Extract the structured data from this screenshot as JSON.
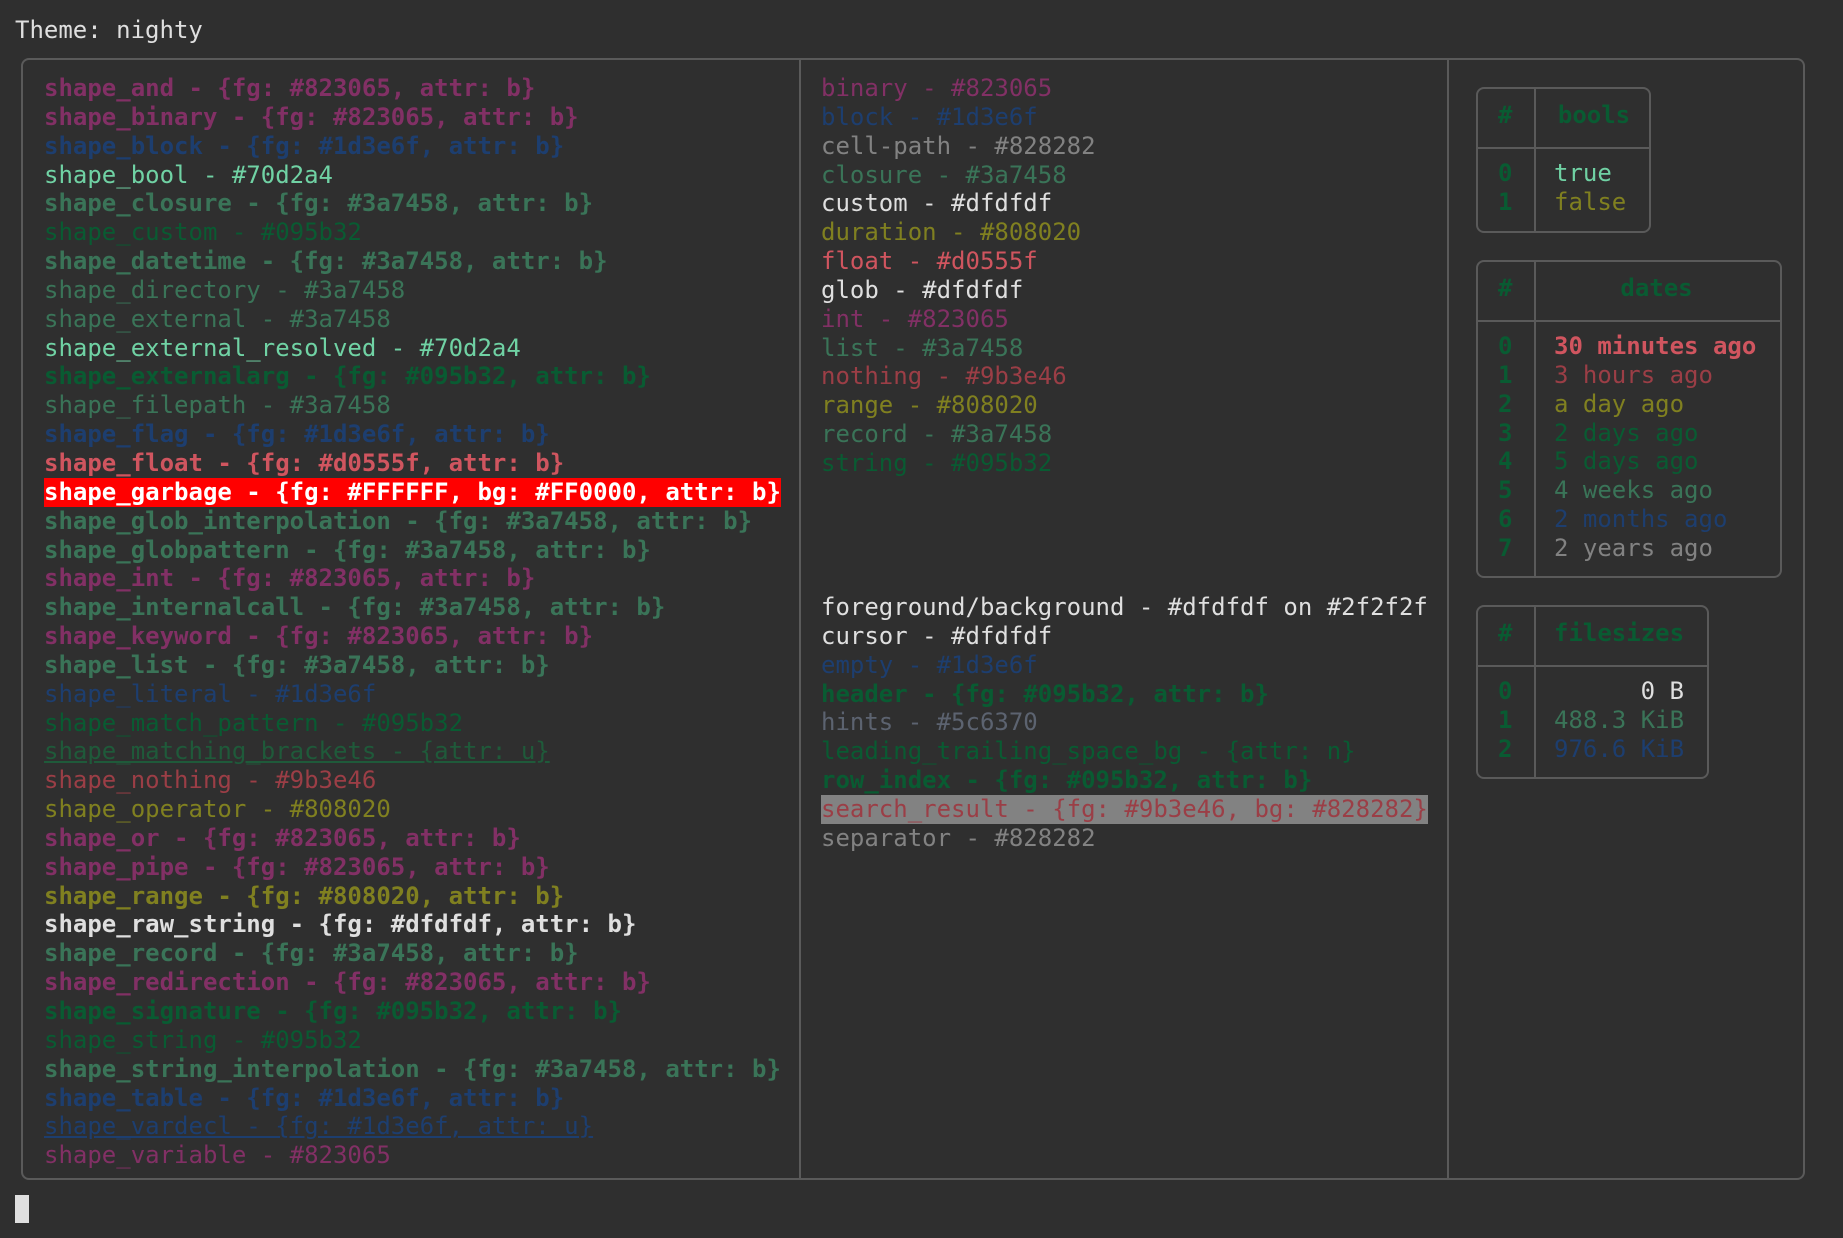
{
  "title": "Theme: nighty",
  "col1": [
    {
      "text": "shape_and - {fg: #823065, attr: b}",
      "color": "#823065",
      "bold": true
    },
    {
      "text": "shape_binary - {fg: #823065, attr: b}",
      "color": "#823065",
      "bold": true
    },
    {
      "text": "shape_block - {fg: #1d3e6f, attr: b}",
      "color": "#1d3e6f",
      "bold": true
    },
    {
      "text": "shape_bool - #70d2a4",
      "color": "#70d2a4"
    },
    {
      "text": "shape_closure - {fg: #3a7458, attr: b}",
      "color": "#3a7458",
      "bold": true
    },
    {
      "text": "shape_custom - #095b32",
      "color": "#095b32"
    },
    {
      "text": "shape_datetime - {fg: #3a7458, attr: b}",
      "color": "#3a7458",
      "bold": true
    },
    {
      "text": "shape_directory - #3a7458",
      "color": "#3a7458"
    },
    {
      "text": "shape_external - #3a7458",
      "color": "#3a7458"
    },
    {
      "text": "shape_external_resolved - #70d2a4",
      "color": "#70d2a4"
    },
    {
      "text": "shape_externalarg - {fg: #095b32, attr: b}",
      "color": "#095b32",
      "bold": true
    },
    {
      "text": "shape_filepath - #3a7458",
      "color": "#3a7458"
    },
    {
      "text": "shape_flag - {fg: #1d3e6f, attr: b}",
      "color": "#1d3e6f",
      "bold": true
    },
    {
      "text": "shape_float - {fg: #d0555f, attr: b}",
      "color": "#d0555f",
      "bold": true
    },
    {
      "text": "shape_garbage - {fg: #FFFFFF, bg: #FF0000, attr: b}",
      "color": "#FFFFFF",
      "bg": "#FF0000",
      "bold": true
    },
    {
      "text": "shape_glob_interpolation - {fg: #3a7458, attr: b}",
      "color": "#3a7458",
      "bold": true
    },
    {
      "text": "shape_globpattern - {fg: #3a7458, attr: b}",
      "color": "#3a7458",
      "bold": true
    },
    {
      "text": "shape_int - {fg: #823065, attr: b}",
      "color": "#823065",
      "bold": true
    },
    {
      "text": "shape_internalcall - {fg: #3a7458, attr: b}",
      "color": "#3a7458",
      "bold": true
    },
    {
      "text": "shape_keyword - {fg: #823065, attr: b}",
      "color": "#823065",
      "bold": true
    },
    {
      "text": "shape_list - {fg: #3a7458, attr: b}",
      "color": "#3a7458",
      "bold": true
    },
    {
      "text": "shape_literal - #1d3e6f",
      "color": "#1d3e6f"
    },
    {
      "text": "shape_match_pattern - #095b32",
      "color": "#095b32"
    },
    {
      "text": "shape_matching_brackets - {attr: u}",
      "color": "#1f5a3a",
      "underline": true
    },
    {
      "text": "shape_nothing - #9b3e46",
      "color": "#9b3e46"
    },
    {
      "text": "shape_operator - #808020",
      "color": "#808020"
    },
    {
      "text": "shape_or - {fg: #823065, attr: b}",
      "color": "#823065",
      "bold": true
    },
    {
      "text": "shape_pipe - {fg: #823065, attr: b}",
      "color": "#823065",
      "bold": true
    },
    {
      "text": "shape_range - {fg: #808020, attr: b}",
      "color": "#808020",
      "bold": true
    },
    {
      "text": "shape_raw_string - {fg: #dfdfdf, attr: b}",
      "color": "#dfdfdf",
      "bold": true
    },
    {
      "text": "shape_record - {fg: #3a7458, attr: b}",
      "color": "#3a7458",
      "bold": true
    },
    {
      "text": "shape_redirection - {fg: #823065, attr: b}",
      "color": "#823065",
      "bold": true
    },
    {
      "text": "shape_signature - {fg: #095b32, attr: b}",
      "color": "#095b32",
      "bold": true
    },
    {
      "text": "shape_string - #095b32",
      "color": "#095b32"
    },
    {
      "text": "shape_string_interpolation - {fg: #3a7458, attr: b}",
      "color": "#3a7458",
      "bold": true
    },
    {
      "text": "shape_table - {fg: #1d3e6f, attr: b}",
      "color": "#1d3e6f",
      "bold": true
    },
    {
      "text": "shape_vardecl - {fg: #1d3e6f, attr: u}",
      "color": "#1d3e6f",
      "underline": true
    },
    {
      "text": "shape_variable - #823065",
      "color": "#823065"
    }
  ],
  "col2_top": [
    {
      "text": "binary - #823065",
      "color": "#823065"
    },
    {
      "text": "block - #1d3e6f",
      "color": "#1d3e6f"
    },
    {
      "text": "cell-path - #828282",
      "color": "#828282"
    },
    {
      "text": "closure - #3a7458",
      "color": "#3a7458"
    },
    {
      "text": "custom - #dfdfdf",
      "color": "#dfdfdf"
    },
    {
      "text": "duration - #808020",
      "color": "#808020"
    },
    {
      "text": "float - #d0555f",
      "color": "#d0555f"
    },
    {
      "text": "glob - #dfdfdf",
      "color": "#dfdfdf"
    },
    {
      "text": "int - #823065",
      "color": "#823065"
    },
    {
      "text": "list - #3a7458",
      "color": "#3a7458"
    },
    {
      "text": "nothing - #9b3e46",
      "color": "#9b3e46"
    },
    {
      "text": "range - #808020",
      "color": "#808020"
    },
    {
      "text": "record - #3a7458",
      "color": "#3a7458"
    },
    {
      "text": "string - #095b32",
      "color": "#095b32"
    }
  ],
  "col2_bottom": [
    {
      "text": "foreground/background - #dfdfdf on #2f2f2f",
      "color": "#dfdfdf"
    },
    {
      "text": "cursor - #dfdfdf",
      "color": "#dfdfdf"
    },
    {
      "text": "empty - #1d3e6f",
      "color": "#1d3e6f"
    },
    {
      "text": "header - {fg: #095b32, attr: b}",
      "color": "#095b32",
      "bold": true
    },
    {
      "text": "hints - #5c6370",
      "color": "#5c6370"
    },
    {
      "text": "leading_trailing_space_bg - {attr: n}",
      "color": "#095b32"
    },
    {
      "text": "row_index - {fg: #095b32, attr: b}",
      "color": "#095b32",
      "bold": true
    },
    {
      "text": "search_result - {fg: #9b3e46, bg: #828282}",
      "color": "#9b3e46",
      "bg": "#828282"
    },
    {
      "text": "separator - #828282",
      "color": "#828282"
    }
  ],
  "tables": {
    "bools": {
      "index_header": "#",
      "header": "bools",
      "rows": [
        {
          "idx": "0",
          "val": "true",
          "color": "#70d2a4"
        },
        {
          "idx": "1",
          "val": "false",
          "color": "#808020"
        }
      ]
    },
    "dates": {
      "index_header": "#",
      "header": "dates",
      "rows": [
        {
          "idx": "0",
          "val": "30 minutes ago",
          "color": "#d0555f",
          "bold": true
        },
        {
          "idx": "1",
          "val": "3 hours ago",
          "color": "#9b3e46"
        },
        {
          "idx": "2",
          "val": "a day ago",
          "color": "#808020"
        },
        {
          "idx": "3",
          "val": "2 days ago",
          "color": "#095b32"
        },
        {
          "idx": "4",
          "val": "5 days ago",
          "color": "#095b32"
        },
        {
          "idx": "5",
          "val": "4 weeks ago",
          "color": "#3a7458"
        },
        {
          "idx": "6",
          "val": "2 months ago",
          "color": "#1d3e6f"
        },
        {
          "idx": "7",
          "val": "2 years ago",
          "color": "#828282"
        }
      ]
    },
    "filesizes": {
      "index_header": "#",
      "header": "filesizes",
      "rows": [
        {
          "idx": "0",
          "val": "0 B",
          "color": "#dfdfdf"
        },
        {
          "idx": "1",
          "val": "488.3 KiB",
          "color": "#3a7458"
        },
        {
          "idx": "2",
          "val": "976.6 KiB",
          "color": "#1d3e6f"
        }
      ]
    }
  },
  "colors": {
    "background": "#2f2f2f",
    "foreground": "#dfdfdf",
    "border": "#5a5a5a",
    "header": "#095b32",
    "row_index": "#095b32"
  }
}
